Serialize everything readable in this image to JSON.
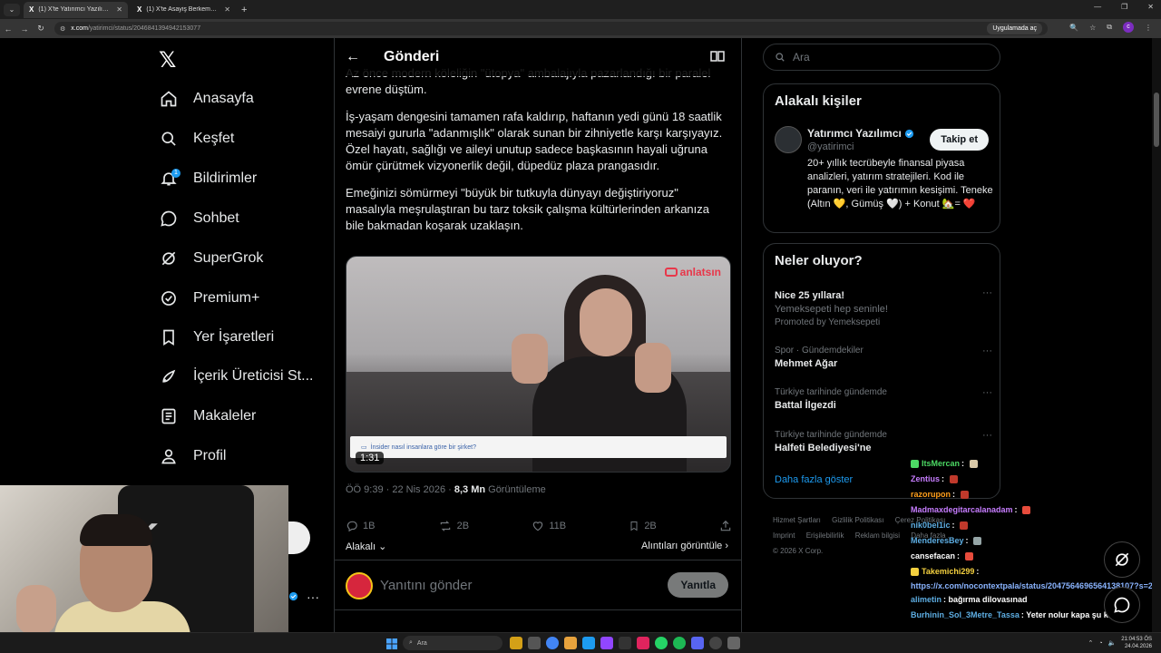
{
  "browser": {
    "tabs": [
      {
        "title": "(1) X'te Yatırımcı Yazılımcı: \"Az önce...",
        "active": true
      },
      {
        "title": "(1) X'te Asayiş Berkemal: \"Çekim...",
        "active": false
      }
    ],
    "url_host": "x.com",
    "url_path": "/yatirimci/status/2046841394942153077",
    "open_in_app": "Uygulamada aç"
  },
  "sidebar": {
    "items": [
      {
        "label": "Anasayfa",
        "icon": "home-icon"
      },
      {
        "label": "Keşfet",
        "icon": "search-icon"
      },
      {
        "label": "Bildirimler",
        "icon": "bell-icon",
        "badge": "1"
      },
      {
        "label": "Sohbet",
        "icon": "chat-icon"
      },
      {
        "label": "SuperGrok",
        "icon": "grok-icon"
      },
      {
        "label": "Premium+",
        "icon": "verified-icon"
      },
      {
        "label": "Yer İşaretleri",
        "icon": "bookmark-icon"
      },
      {
        "label": "İçerik Üreticisi St...",
        "icon": "rocket-icon"
      },
      {
        "label": "Makaleler",
        "icon": "article-icon"
      },
      {
        "label": "Profil",
        "icon": "person-icon"
      }
    ]
  },
  "main": {
    "header_title": "Gönderi",
    "post": {
      "paragraphs": [
        "Az önce modern köleliğin \"ütopya\" ambalajıyla pazarlandığı bir paralel evrene düştüm.",
        "İş-yaşam dengesini tamamen rafa kaldırıp, haftanın yedi günü 18 saatlik mesaiyi gururla \"adanmışlık\" olarak sunan bir zihniyetle karşı karşıyayız. Özel hayatı, sağlığı ve aileyi unutup sadece başkasının hayali uğruna ömür çürütmek vizyonerlik değil, düpedüz plaza prangasıdır.",
        "Emeğinizi sömürmeyi \"büyük bir tutkuyla dünyayı değiştiriyoruz\" masalıyla meşrulaştıran bu tarz toksik çalışma kültürlerinden arkanıza bile bakmadan koşarak uzaklaşın."
      ],
      "video": {
        "watermark": "anlatsın",
        "ad_text": "İnsider nasıl insanlara göre bir şirket?",
        "duration": "1:31"
      },
      "time": "ÖÖ 9:39 · 22 Nis 2026 · ",
      "views": "8,3 Mn",
      "views_label": " Görüntüleme",
      "stats": {
        "replies": "1B",
        "reposts": "2B",
        "likes": "11B",
        "bookmarks": "2B"
      },
      "relevance": "Alakalı",
      "quotes": "Alıntıları görüntüle"
    },
    "reply_placeholder": "Yanıtını gönder",
    "reply_button": "Yanıtla"
  },
  "right": {
    "search_placeholder": "Ara",
    "who": {
      "title": "Alakalı kişiler",
      "name": "Yatırımcı Yazılımcı",
      "handle": "@yatirimci",
      "follow": "Takip et",
      "bio": "20+ yıllık tecrübeyle finansal piyasa analizleri, yatırım stratejileri. Kod ile paranın, veri ile yatırımın kesişimi. Teneke (Altın 💛, Gümüş 🤍) + Konut 🏡= ❤️"
    },
    "trends": {
      "title": "Neler oluyor?",
      "items": [
        {
          "context": "",
          "name": "Nice 25 yıllara!",
          "sub": "Yemeksepeti hep seninle!",
          "promo": "Promoted by Yemeksepeti"
        },
        {
          "context": "Spor · Gündemdekiler",
          "name": "Mehmet Ağar",
          "sub": "",
          "promo": ""
        },
        {
          "context": "Türkiye tarihinde gündemde",
          "name": "Battal İlgezdi",
          "sub": "",
          "promo": ""
        },
        {
          "context": "Türkiye tarihinde gündemde",
          "name": "Halfeti Belediyesi'ne",
          "sub": "",
          "promo": ""
        }
      ],
      "show_more": "Daha fazla göster"
    },
    "footer": [
      "Hizmet Şartları",
      "Gizlilik Politikası",
      "Çerez Politikası",
      "Imprint",
      "Erişilebilirlik",
      "Reklam bilgisi",
      "Daha fazla ...",
      "© 2026 X Corp."
    ]
  },
  "chat": [
    {
      "user": "ItsMercan",
      "color": "#4cd964",
      "msg": ""
    },
    {
      "user": "Zentius",
      "color": "#c77dff",
      "msg": ""
    },
    {
      "user": "razorupon",
      "color": "#ff9f1c",
      "msg": ""
    },
    {
      "user": "Madmaxdegitarcalanadam",
      "color": "#c77dff",
      "msg": ""
    },
    {
      "user": "nik0bel1ic",
      "color": "#5dade2",
      "msg": ""
    },
    {
      "user": "MenderesBey",
      "color": "#5dade2",
      "msg": ""
    },
    {
      "user": "cansefacan",
      "color": "#ffffff",
      "msg": ""
    },
    {
      "user": "Takemichi299",
      "color": "#f4d03f",
      "msg": ""
    },
    {
      "user": "",
      "color": "#8ab4ff",
      "msg": "https://x.com/nocontextpala/status/2047564696564138107?s=20"
    },
    {
      "user": "alimetin",
      "color": "#5dade2",
      "msg": "bağırma dilovasınad"
    },
    {
      "user": "Burhinin_Sol_3Metre_Tassa",
      "color": "#5dade2",
      "msg": "Yeter nolur kapa şu karıyı"
    }
  ],
  "taskbar": {
    "search": "Ara",
    "time": "21:04:53 ÖS",
    "date": "24.04.2026"
  }
}
